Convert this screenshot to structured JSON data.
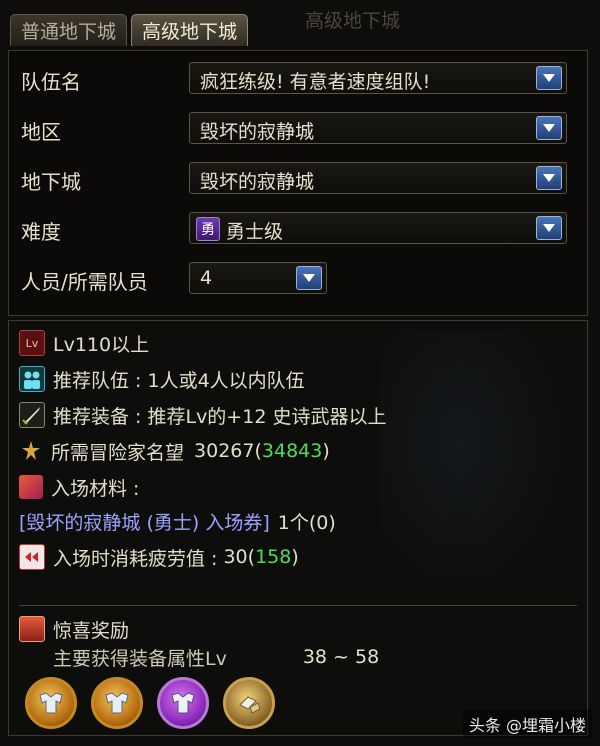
{
  "tabs": [
    {
      "label": "普通地下城"
    },
    {
      "label": "高级地下城"
    }
  ],
  "background_heading": "高级地下城",
  "form": {
    "team_name": {
      "label": "队伍名",
      "value": "疯狂练级! 有意者速度组队!"
    },
    "region": {
      "label": "地区",
      "value": "毁坏的寂静城"
    },
    "dungeon": {
      "label": "地下城",
      "value": "毁坏的寂静城"
    },
    "difficulty": {
      "label": "难度",
      "badge": "勇",
      "value": "勇士级"
    },
    "members": {
      "label": "人员/所需队员",
      "value": "4"
    }
  },
  "info": {
    "level": {
      "icon": "level-icon",
      "badge": "Lv",
      "text": "Lv110以上"
    },
    "party": {
      "icon": "party-icon",
      "text": "推荐队伍 : 1人或4人以内队伍"
    },
    "gear": {
      "icon": "sword-icon",
      "text": "推荐装备 : 推荐Lv的+12 史诗武器以上"
    },
    "fame": {
      "icon": "fame-icon",
      "label": "所需冒险家名望",
      "required": "30267",
      "current": "34843"
    },
    "materials": {
      "icon": "ticket-icon",
      "label": "入场材料 :"
    },
    "ticket": {
      "name": "[毁坏的寂静城 (勇士) 入场券]",
      "qty": "1个(0)"
    },
    "fatigue": {
      "icon": "fatigue-icon",
      "label": "入场时消耗疲劳值 :",
      "cost": "30",
      "current": "158"
    }
  },
  "reward": {
    "icon": "chest-icon",
    "title": "惊喜奖励",
    "subtitle": "主要获得装备属性Lv",
    "range": "38 ~ 58",
    "items": [
      {
        "name": "armor-reward-icon",
        "color": "#f5c65a"
      },
      {
        "name": "armor-reward-icon",
        "color": "#f5c65a"
      },
      {
        "name": "armor-reward-icon",
        "color": "#d778f0"
      },
      {
        "name": "material-reward-icon",
        "color": "#f2d27a"
      }
    ]
  },
  "watermark": "头条 @埋霜小楼"
}
